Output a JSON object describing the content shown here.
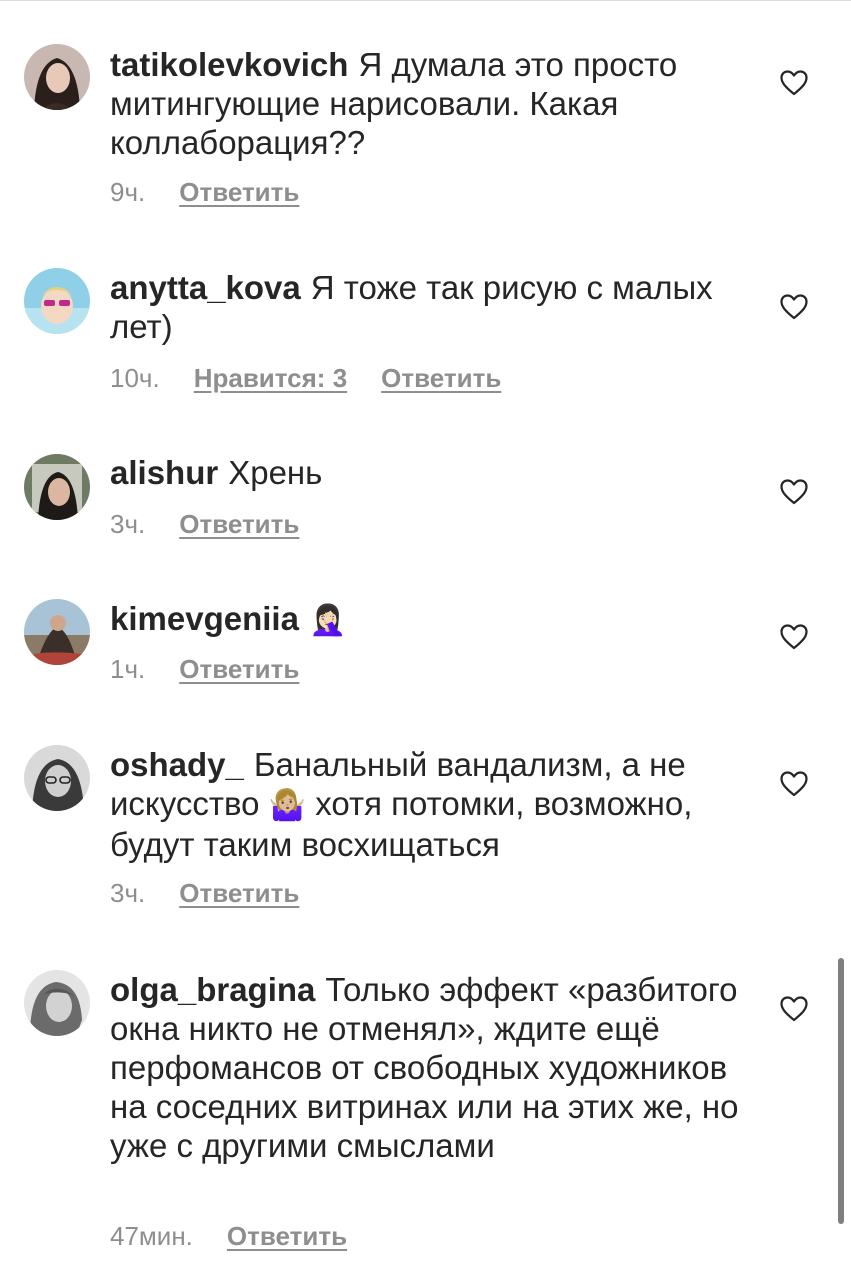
{
  "comments": [
    {
      "username": "tatikolevkovich",
      "text": "Я думала это просто митингующие нарисовали. Какая коллаборация??",
      "time": "9ч.",
      "likes_label": "",
      "reply_label": "Ответить"
    },
    {
      "username": "anytta_kova",
      "text": "Я тоже так рисую с малых лет)",
      "time": "10ч.",
      "likes_label": "Нравится: 3",
      "reply_label": "Ответить"
    },
    {
      "username": "alishur",
      "text": "Хрень",
      "time": "3ч.",
      "likes_label": "",
      "reply_label": "Ответить"
    },
    {
      "username": "kimevgeniia",
      "text": "",
      "emoji": "🤦🏻‍♀️",
      "time": "1ч.",
      "likes_label": "",
      "reply_label": "Ответить"
    },
    {
      "username": "oshady_",
      "text_before": "Банальный вандализм, а не искусство",
      "emoji": "🤷🏼‍♀️",
      "text_after": "хотя потомки, возможно, будут таким восхищаться",
      "time": "3ч.",
      "likes_label": "",
      "reply_label": "Ответить"
    },
    {
      "username": "olga_bragina",
      "text": "Только эффект «разбитого окна никто не отменял», ждите ещё перфомансов от свободных художников на соседних витринах или на этих же, но уже с другими смыслами",
      "time": "47мин.",
      "likes_label": "",
      "reply_label": "Ответить"
    }
  ],
  "icons": {
    "like": "heart-outline-icon"
  },
  "colors": {
    "text": "#262626",
    "secondary": "#8e8e8e",
    "divider": "#dbdbdb"
  }
}
